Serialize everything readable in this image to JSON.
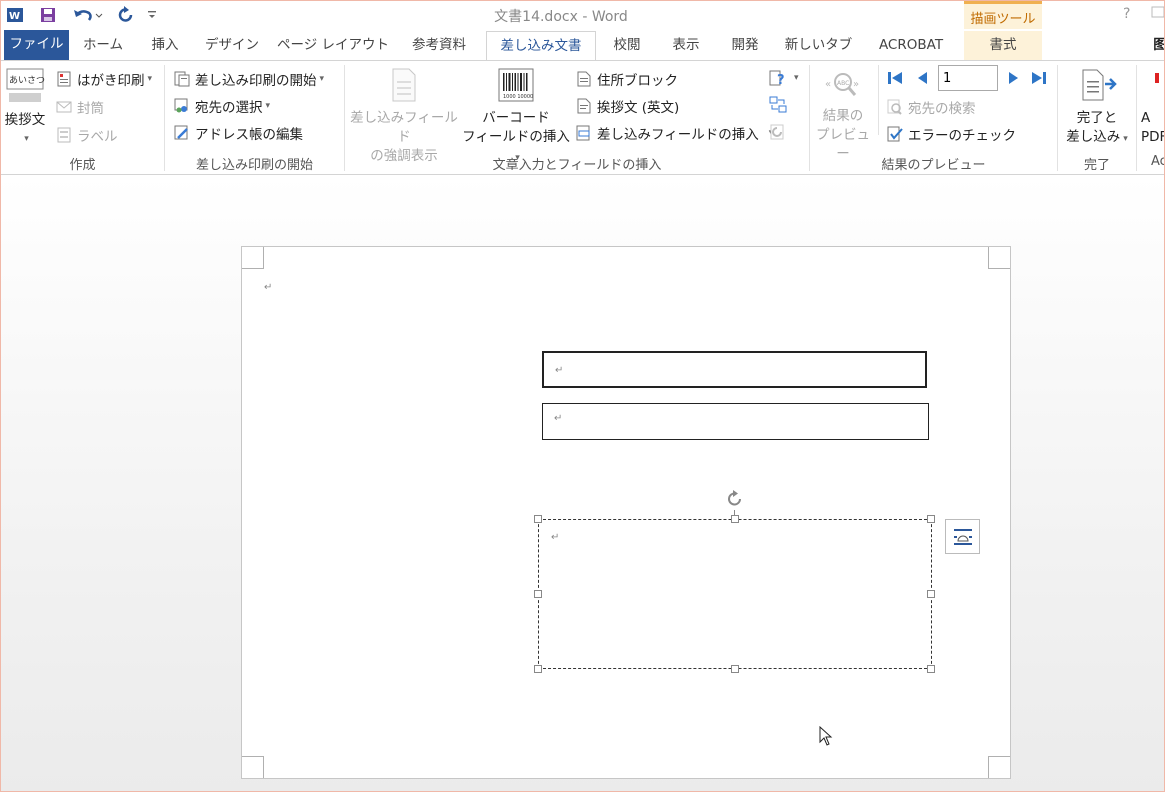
{
  "window": {
    "title": "文書14.docx - Word",
    "context_tool": "描画ツール",
    "help": "?"
  },
  "tabs": [
    {
      "label": "ファイル"
    },
    {
      "label": "ホーム"
    },
    {
      "label": "挿入"
    },
    {
      "label": "デザイン"
    },
    {
      "label": "ページ レイアウト"
    },
    {
      "label": "参考資料"
    },
    {
      "label": "差し込み文書"
    },
    {
      "label": "校閲"
    },
    {
      "label": "表示"
    },
    {
      "label": "開発"
    },
    {
      "label": "新しいタブ"
    },
    {
      "label": "ACROBAT"
    },
    {
      "label": "書式"
    }
  ],
  "ribbon": {
    "create": {
      "label": "作成",
      "greeting": "挨拶文",
      "greeting_icon_text": "あいさつ",
      "postcard": "はがき印刷",
      "envelope": "封筒",
      "labels": "ラベル"
    },
    "start": {
      "label": "差し込み印刷の開始",
      "start_merge": "差し込み印刷の開始",
      "select_recipients": "宛先の選択",
      "edit_list": "アドレス帳の編集"
    },
    "fields": {
      "label": "文章入力とフィールドの挿入",
      "highlight_line1": "差し込みフィールド",
      "highlight_line2": "の強調表示",
      "barcode_line1": "バーコード",
      "barcode_line2": "フィールドの挿入",
      "barcode_digits": "1000 10000",
      "address_block": "住所ブロック",
      "greeting_en": "挨拶文 (英文)",
      "insert_field": "差し込みフィールドの挿入"
    },
    "preview": {
      "label": "結果のプレビュー",
      "preview_line1": "結果の",
      "preview_line2": "プレビュー",
      "preview_icon_text": "ABC",
      "record": "1",
      "find_recipient": "宛先の検索",
      "check_errors": "エラーのチェック"
    },
    "finish": {
      "label": "完了",
      "finish_line1": "完了と",
      "finish_line2": "差し込み"
    },
    "acrobat": {
      "line1": "A",
      "line2": "PDF",
      "label": "Ac"
    }
  },
  "document": {
    "para_mark": "↵"
  },
  "colors": {
    "file_tab": "#2b579a",
    "active_tab_text": "#2b579a",
    "context_tab": "#c06b00",
    "context_bg": "#fdf2d9"
  }
}
